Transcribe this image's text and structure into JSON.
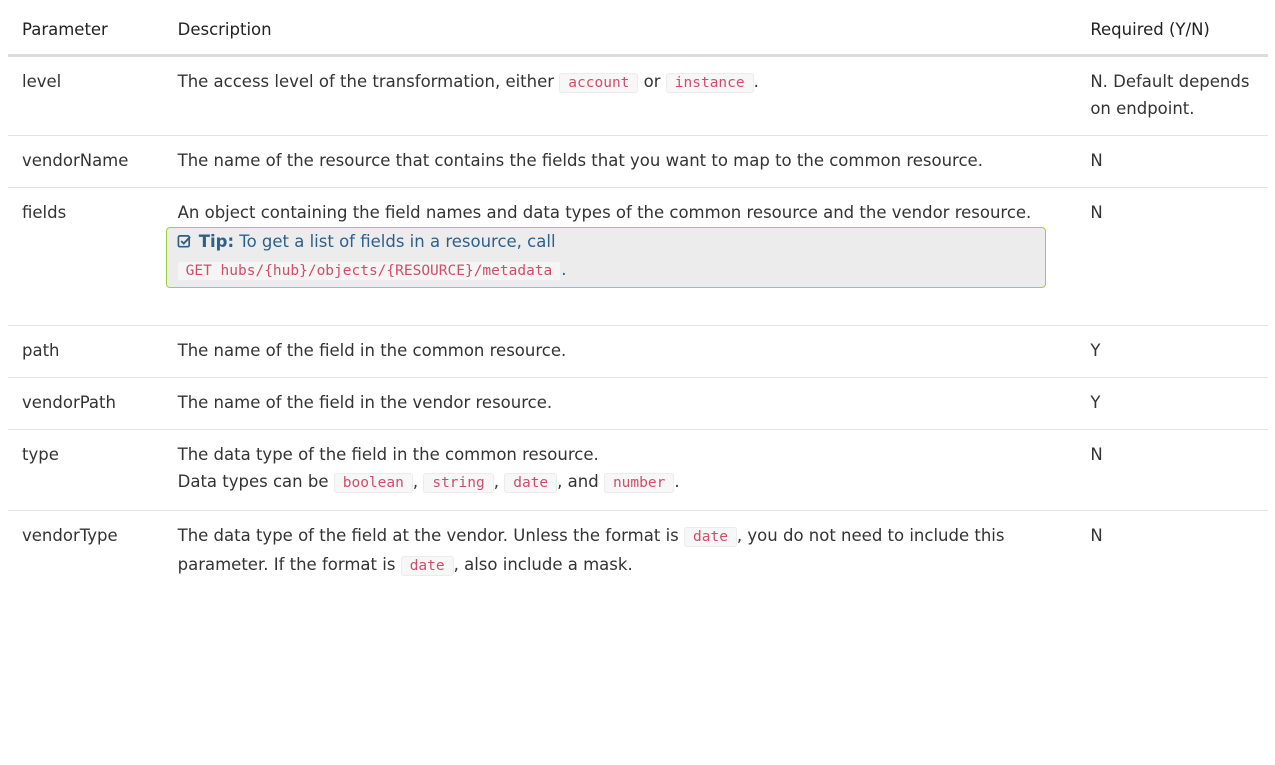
{
  "headers": {
    "parameter": "Parameter",
    "description": "Description",
    "required": "Required (Y/N)"
  },
  "rows": {
    "level": {
      "name": "level",
      "desc_pre": "The access level of the transformation, either ",
      "code1": "account",
      "desc_mid": " or ",
      "code2": "instance",
      "desc_post": ".",
      "required": "N. Default depends on endpoint."
    },
    "vendorName": {
      "name": "vendorName",
      "desc": "The name of the resource that contains the fields that you want to map to the common resource.",
      "required": "N"
    },
    "fields": {
      "name": "fields",
      "desc": "An object containing the field names and data types of the common resource and the vendor resource.",
      "tip_label": "Tip:",
      "tip_text": " To get a list of fields in a resource, call",
      "tip_code": "GET hubs/{hub}/objects/{RESOURCE}/metadata",
      "tip_post": ".",
      "required": "N"
    },
    "path": {
      "name": "path",
      "desc": "The name of the field in the common resource.",
      "required": "Y"
    },
    "vendorPath": {
      "name": "vendorPath",
      "desc": "The name of the field in the vendor resource.",
      "required": "Y"
    },
    "type": {
      "name": "type",
      "desc_line1": "The data type of the field in the common resource.",
      "desc_pre": "Data types can be ",
      "code1": "boolean",
      "sep1": ", ",
      "code2": "string",
      "sep2": ", ",
      "code3": "date",
      "sep3": ", and ",
      "code4": "number",
      "desc_post": ".",
      "required": "N"
    },
    "vendorType": {
      "name": "vendorType",
      "desc_pre": "The data type of the field at the vendor. Unless the format is ",
      "code1": "date",
      "desc_mid": ", you do not need to include this parameter. If the format is ",
      "code2": "date",
      "desc_post": ", also include a mask.",
      "required": "N"
    }
  },
  "colors": {
    "code_text": "#d14d6a",
    "tip_border": "#9fd13c",
    "tip_text": "#2c5f8a"
  },
  "icons": {
    "tip": "check-square-icon"
  }
}
